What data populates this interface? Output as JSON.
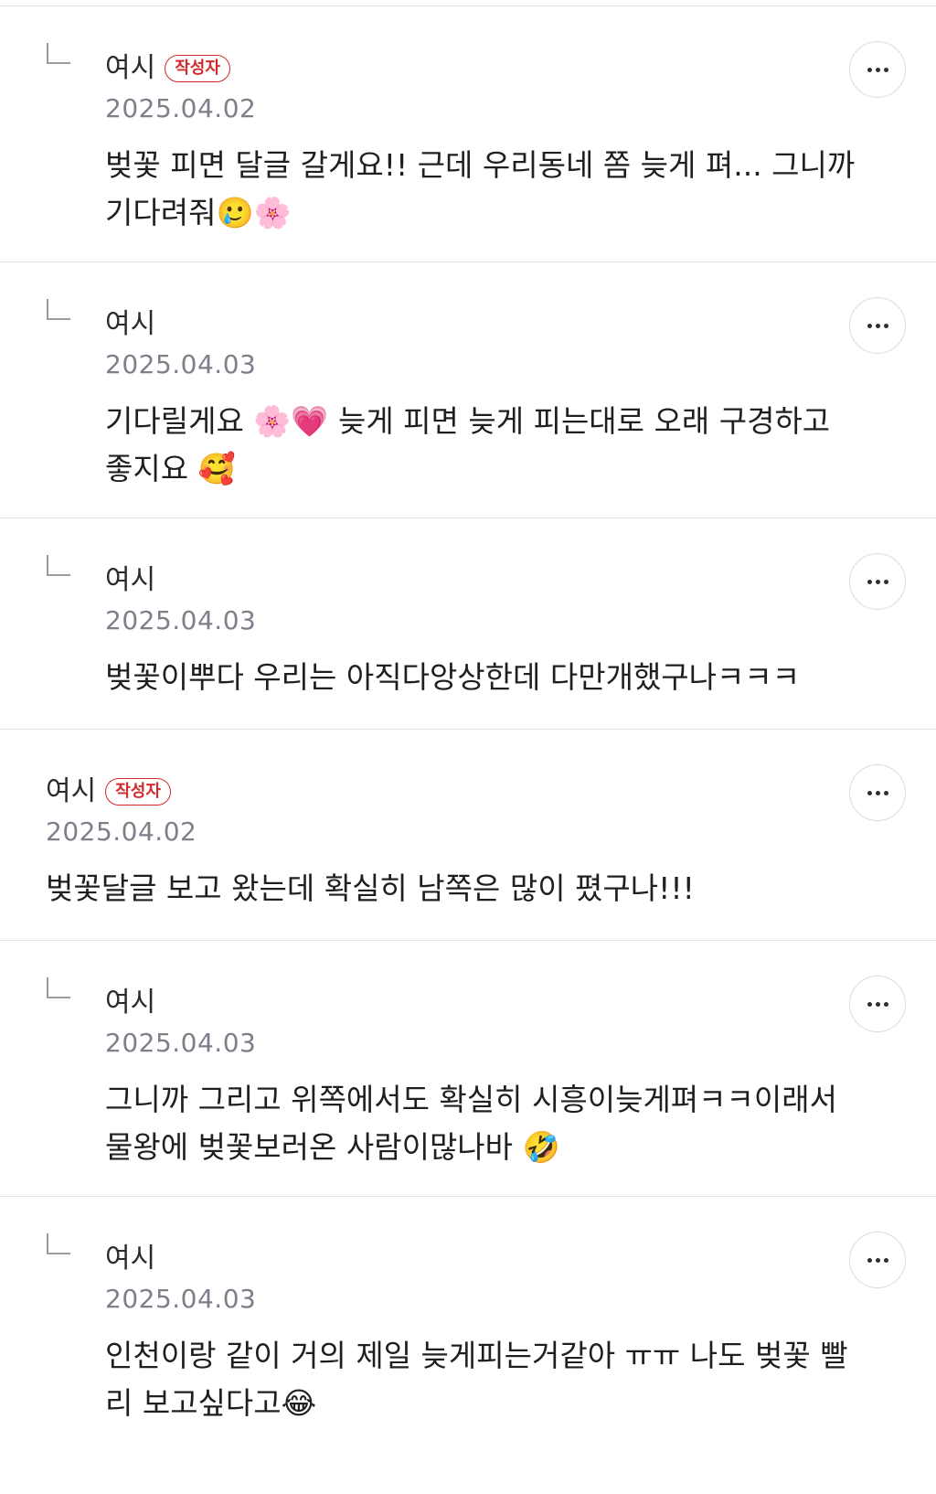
{
  "comments": [
    {
      "author": "여시",
      "is_writer": true,
      "badge": "작성자",
      "date": "2025.04.02",
      "text": "벚꽃 피면 달글 갈게요!! 근데 우리동네 쫌 늦게 펴... 그니까 기다려줘🥲🌸",
      "reply": true
    },
    {
      "author": "여시",
      "is_writer": false,
      "badge": "",
      "date": "2025.04.03",
      "text": "기다릴게요 🌸💗 늦게 피면 늦게 피는대로 오래 구경하고 좋지요 🥰",
      "reply": true
    },
    {
      "author": "여시",
      "is_writer": false,
      "badge": "",
      "date": "2025.04.03",
      "text": "벚꽃이뿌다 우리는 아직다앙상한데 다만개했구나ㅋㅋㅋ",
      "reply": true
    },
    {
      "author": "여시",
      "is_writer": true,
      "badge": "작성자",
      "date": "2025.04.02",
      "text": "벚꽃달글 보고 왔는데 확실히 남쪽은 많이 폈구나!!!",
      "reply": false
    },
    {
      "author": "여시",
      "is_writer": false,
      "badge": "",
      "date": "2025.04.03",
      "text": "그니까 그리고 위쪽에서도 확실히 시흥이늦게펴ㅋㅋ이래서 물왕에 벚꽃보러온 사람이많나바 🤣",
      "reply": true
    },
    {
      "author": "여시",
      "is_writer": false,
      "badge": "",
      "date": "2025.04.03",
      "text": "인천이랑 같이 거의 제일 늦게피는거같아 ㅠㅠ 나도 벚꽃 빨리 보고싶다고😂",
      "reply": true
    }
  ],
  "icons": {
    "reply": "reply-arrow-icon",
    "more": "more-horizontal-icon"
  },
  "colors": {
    "badge": "#d22a2a",
    "date": "#7d7f8a",
    "divider": "#e3e3e6"
  }
}
